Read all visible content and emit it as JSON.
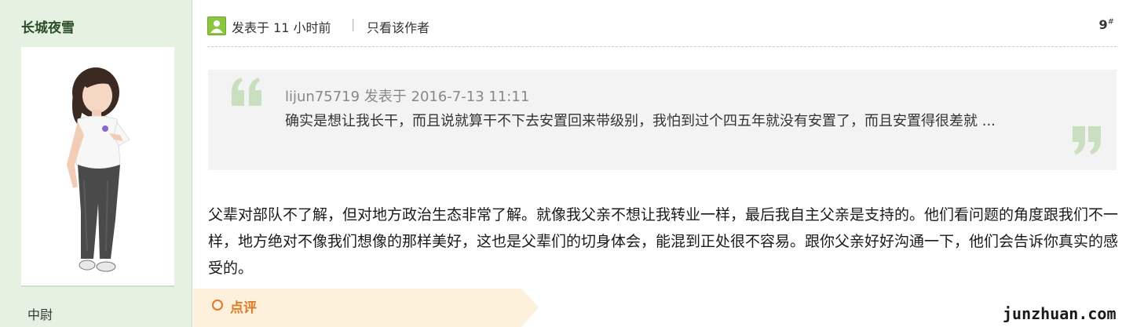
{
  "sidebar": {
    "username": "长城夜雪",
    "rank": "中尉"
  },
  "post": {
    "time_text": "发表于 11 小时前",
    "separator": "|",
    "only_author": "只看该作者",
    "floor_number": "9",
    "floor_suffix": "#"
  },
  "quote": {
    "meta": "lijun75719 发表于 2016-7-13 11:11",
    "text": "确实是想让我长干，而且说就算干不下去安置回来带级别，我怕到过个四五年就没有安置了，而且安置得很差就 ..."
  },
  "message": {
    "text": "父辈对部队不了解，但对地方政治生态非常了解。就像我父亲不想让我转业一样，最后我自主父亲是支持的。他们看问题的角度跟我们不一样，地方绝对不像我们想像的那样美好，这也是父辈们的切身体会，能混到正处很不容易。跟你父亲好好沟通一下，他们会告诉你真实的感受的。"
  },
  "comment": {
    "label": "点评"
  },
  "watermark": "junzhuan.com",
  "colors": {
    "sidebar_bg": "#e6f2e1",
    "username": "#2b4d2b",
    "quote_bg": "#f3f3f3",
    "quote_mark": "#c9dfc0",
    "comment_accent": "#e07a2a",
    "comment_bar": "#fdf1dc"
  },
  "icons": {
    "poster": "user-icon",
    "quote_open": "open-quote-icon",
    "quote_close": "close-quote-icon",
    "comment": "circle-icon"
  }
}
